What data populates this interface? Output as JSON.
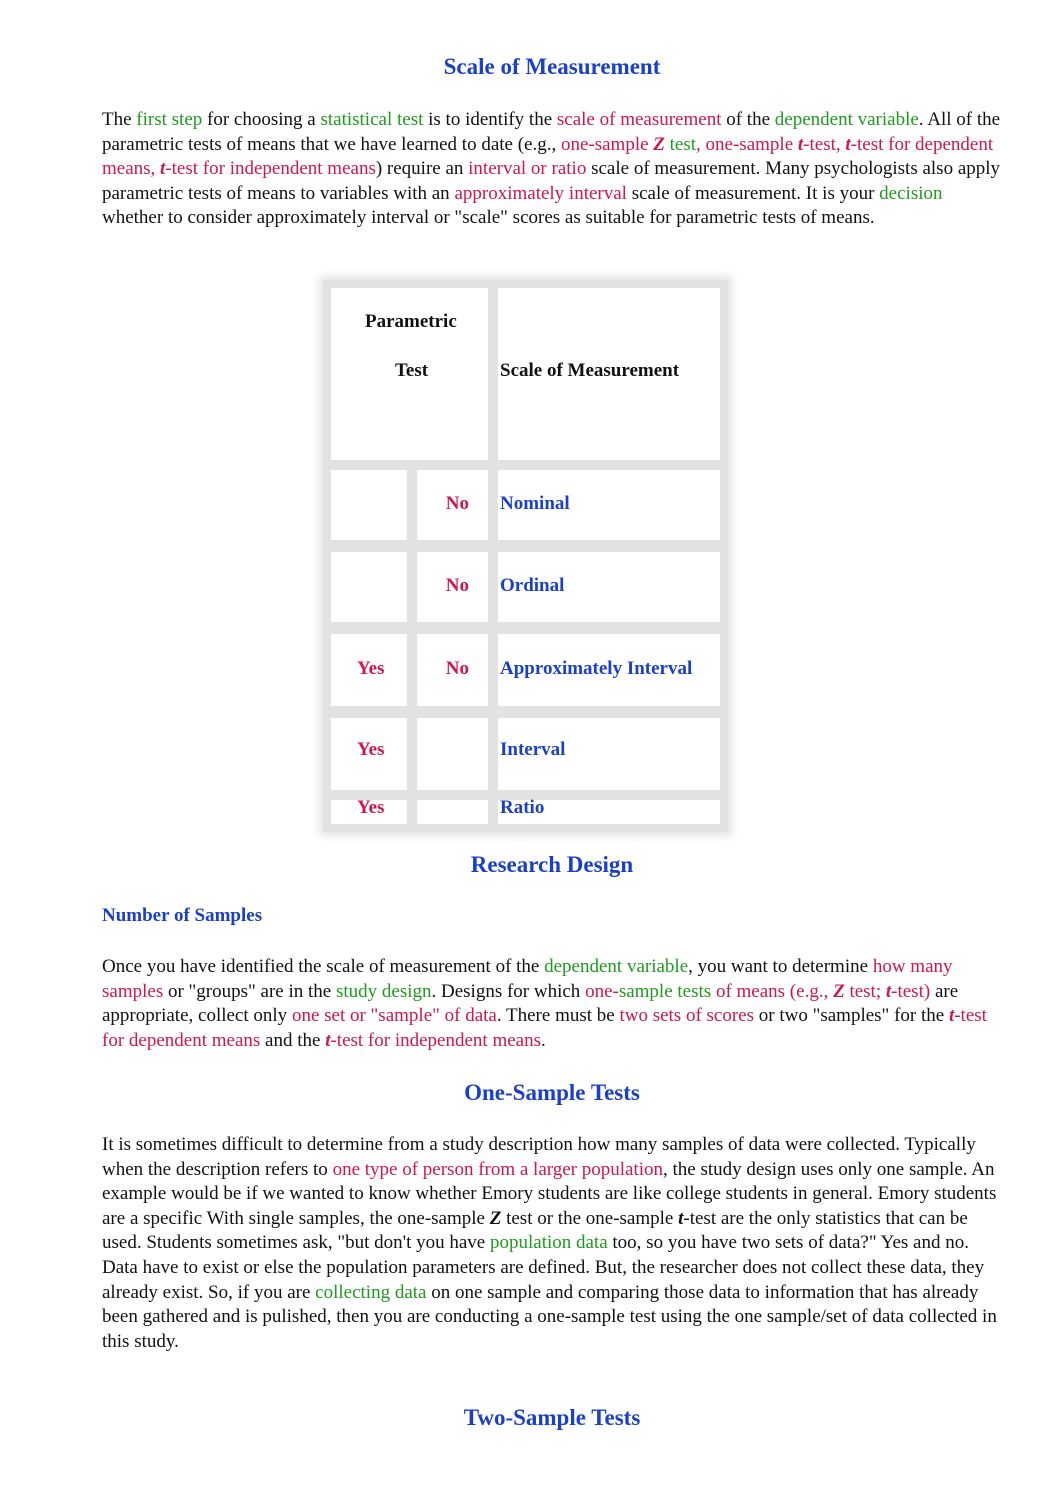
{
  "sections": {
    "scale": {
      "heading": "Scale of Measurement",
      "paragraph": [
        {
          "t": "The ",
          "c": ""
        },
        {
          "t": "first step",
          "c": "g"
        },
        {
          "t": " for choosing a ",
          "c": ""
        },
        {
          "t": "statistical test",
          "c": "g"
        },
        {
          "t": " is to identify the ",
          "c": ""
        },
        {
          "t": "scale of measurement",
          "c": "r"
        },
        {
          "t": " of the ",
          "c": ""
        },
        {
          "t": "dependent variable",
          "c": "g"
        },
        {
          "t": ". All of the parametric tests of means that we have learned to date (e.g., ",
          "c": ""
        },
        {
          "t": "one-sample ",
          "c": "r"
        },
        {
          "t": "Z",
          "c": "r bi"
        },
        {
          "t": " test",
          "c": "g"
        },
        {
          "t": ", one-sample ",
          "c": "r"
        },
        {
          "t": "t",
          "c": "r bi"
        },
        {
          "t": "-test, ",
          "c": "r"
        },
        {
          "t": "t",
          "c": "r bi"
        },
        {
          "t": "-test for dependent means, ",
          "c": "r"
        },
        {
          "t": "t",
          "c": "r bi"
        },
        {
          "t": "-test for independent means",
          "c": "r"
        },
        {
          "t": ") require an ",
          "c": ""
        },
        {
          "t": "interval or ratio",
          "c": "r"
        },
        {
          "t": " scale of measurement. Many psychologists also apply parametric tests of means to variables with an ",
          "c": ""
        },
        {
          "t": "approximately interval",
          "c": "r"
        },
        {
          "t": " scale of measurement. It is your ",
          "c": ""
        },
        {
          "t": "decision",
          "c": "g"
        },
        {
          "t": " whether to consider approximately interval or \"scale\" scores as suitable for parametric tests of means.",
          "c": ""
        }
      ]
    },
    "table": {
      "header_col1_line1": "Parametric",
      "header_col1_line2": "Test",
      "header_col2": "Scale of Measurement",
      "rows": [
        {
          "a": "",
          "b": "No",
          "scale": "Nominal"
        },
        {
          "a": "",
          "b": "No",
          "scale": "Ordinal"
        },
        {
          "a": "Yes",
          "b": "No",
          "scale": "Approximately Interval"
        },
        {
          "a": "Yes",
          "b": "",
          "scale": "Interval"
        },
        {
          "a": "Yes",
          "b": "",
          "scale": "Ratio"
        }
      ]
    },
    "research": {
      "heading": "Research Design",
      "subheading": "Number of Samples",
      "paragraph": [
        {
          "t": "Once you have identified the scale of measurement of the ",
          "c": ""
        },
        {
          "t": "dependent variable",
          "c": "g"
        },
        {
          "t": ", you want to determine ",
          "c": ""
        },
        {
          "t": "how many samples",
          "c": "r"
        },
        {
          "t": " or \"groups\" are in the ",
          "c": ""
        },
        {
          "t": "study design",
          "c": "g"
        },
        {
          "t": ". Designs for which ",
          "c": ""
        },
        {
          "t": "one-",
          "c": "r"
        },
        {
          "t": "sample tests",
          "c": "g"
        },
        {
          "t": " of means (e.g., ",
          "c": "r"
        },
        {
          "t": "Z",
          "c": "r bi"
        },
        {
          "t": " test; ",
          "c": "r"
        },
        {
          "t": "t",
          "c": "r bi"
        },
        {
          "t": "-test)",
          "c": "r"
        },
        {
          "t": " are appropriate, collect only ",
          "c": ""
        },
        {
          "t": "one set or \"sample\" of data",
          "c": "r"
        },
        {
          "t": ". There must be ",
          "c": ""
        },
        {
          "t": "two sets of scores",
          "c": "r"
        },
        {
          "t": " or two \"samples\" for the ",
          "c": ""
        },
        {
          "t": "t",
          "c": "r bi"
        },
        {
          "t": "-test for dependent means",
          "c": "r"
        },
        {
          "t": " and the ",
          "c": ""
        },
        {
          "t": "t",
          "c": "r bi"
        },
        {
          "t": "-test for independent means",
          "c": "r"
        },
        {
          "t": ".",
          "c": ""
        }
      ]
    },
    "one_sample": {
      "heading": "One-Sample Tests",
      "paragraph": [
        {
          "t": "It is sometimes difficult to determine from a study description how many samples of data were collected. Typically when the description refers to ",
          "c": ""
        },
        {
          "t": "one type of person from a larger population",
          "c": "r"
        },
        {
          "t": ", the study design uses only one sample. An example would be if we wanted to know whether Emory students are like college students in general. Emory students are a specific With single samples, the one-sample ",
          "c": ""
        },
        {
          "t": "Z",
          "c": "bi"
        },
        {
          "t": " test or the one-sample ",
          "c": ""
        },
        {
          "t": "t",
          "c": "bi"
        },
        {
          "t": "-test are the only statistics that can be used. Students sometimes ask, \"but don't you have ",
          "c": ""
        },
        {
          "t": "population data",
          "c": "g"
        },
        {
          "t": " too, so you have two sets of data?\" Yes and no. Data have to exist or else the population parameters are defined. But, the researcher does not collect these data, they already exist. So, if you are ",
          "c": ""
        },
        {
          "t": "collecting data",
          "c": "g"
        },
        {
          "t": " on one sample and comparing those data to information that has already been gathered and is pulished, then you are conducting a one-sample test using the one sample/set of data collected in this study.",
          "c": ""
        }
      ]
    },
    "two_sample": {
      "heading": "Two-Sample Tests"
    }
  }
}
